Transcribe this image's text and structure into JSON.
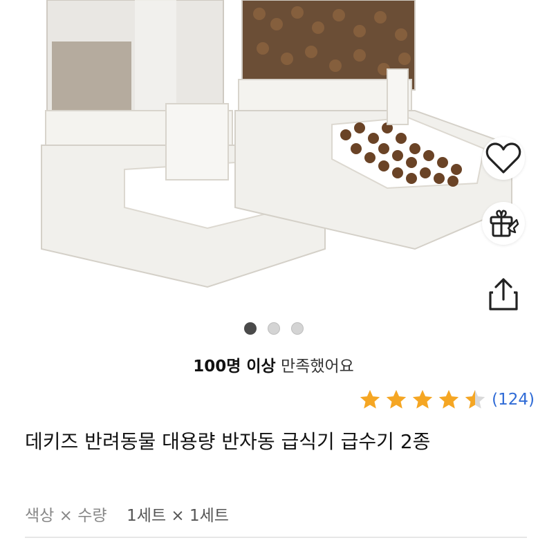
{
  "product": {
    "image_alt": "pet feeder and water dispenser set",
    "carousel": {
      "total": 3,
      "active_index": 0
    },
    "satisfaction": {
      "bold": "100명 이상",
      "rest": " 만족했어요"
    },
    "rating": {
      "stars": 4.5,
      "review_count": "(124)"
    },
    "title": "데키즈 반려동물 대용량 반자동 급식기 급수기 2종",
    "option": {
      "label": "색상 × 수량",
      "value": "1세트 × 1세트"
    }
  },
  "actions": {
    "wishlist_icon": "heart-icon",
    "gift_icon": "gift-icon",
    "share_icon": "share-icon"
  },
  "colors": {
    "star": "#f5a623",
    "link": "#2f6bd6",
    "dot_active": "#4a4a4a"
  }
}
